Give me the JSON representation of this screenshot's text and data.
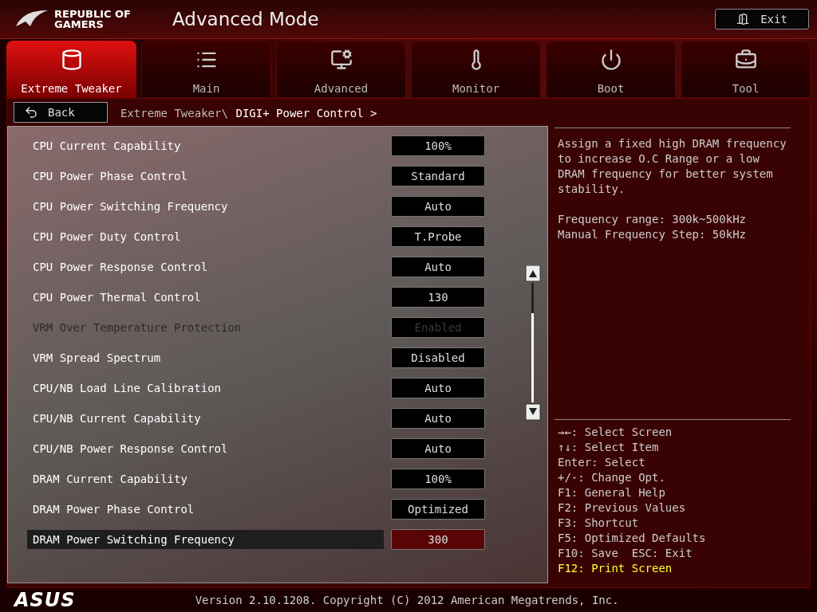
{
  "header": {
    "brand": "REPUBLIC OF GAMERS",
    "title": "Advanced Mode",
    "exit_button": "Exit"
  },
  "tabs": [
    {
      "label": "Extreme Tweaker",
      "kind": "tweaker",
      "selected": true
    },
    {
      "label": "Main",
      "kind": "main",
      "selected": false
    },
    {
      "label": "Advanced",
      "kind": "advanced",
      "selected": false
    },
    {
      "label": "Monitor",
      "kind": "monitor",
      "selected": false
    },
    {
      "label": "Boot",
      "kind": "boot",
      "selected": false
    },
    {
      "label": "Tool",
      "kind": "tool",
      "selected": false
    }
  ],
  "back_button": "Back",
  "breadcrumb": {
    "parent": "Extreme Tweaker\\",
    "current": "DIGI+ Power Control >"
  },
  "settings": [
    {
      "label": "CPU Current Capability",
      "value": "100%",
      "disabled": false,
      "selected": false
    },
    {
      "label": "CPU Power Phase Control",
      "value": "Standard",
      "disabled": false,
      "selected": false
    },
    {
      "label": "CPU Power Switching Frequency",
      "value": "Auto",
      "disabled": false,
      "selected": false
    },
    {
      "label": "CPU Power Duty Control",
      "value": "T.Probe",
      "disabled": false,
      "selected": false
    },
    {
      "label": "CPU Power Response Control",
      "value": "Auto",
      "disabled": false,
      "selected": false
    },
    {
      "label": "CPU Power Thermal Control",
      "value": "130",
      "disabled": false,
      "selected": false
    },
    {
      "label": "VRM Over Temperature Protection",
      "value": "Enabled",
      "disabled": true,
      "selected": false
    },
    {
      "label": "VRM Spread Spectrum",
      "value": "Disabled",
      "disabled": false,
      "selected": false
    },
    {
      "label": "CPU/NB Load Line Calibration",
      "value": "Auto",
      "disabled": false,
      "selected": false
    },
    {
      "label": "CPU/NB Current Capability",
      "value": "Auto",
      "disabled": false,
      "selected": false
    },
    {
      "label": "CPU/NB Power Response Control",
      "value": "Auto",
      "disabled": false,
      "selected": false
    },
    {
      "label": "DRAM Current Capability",
      "value": "100%",
      "disabled": false,
      "selected": false
    },
    {
      "label": "DRAM Power Phase Control",
      "value": "Optimized",
      "disabled": false,
      "selected": false
    },
    {
      "label": "DRAM Power Switching Frequency",
      "value": "300",
      "disabled": false,
      "selected": true
    }
  ],
  "help": {
    "description": "Assign a fixed high DRAM frequency to increase O.C Range or a low DRAM frequency for better system stability.",
    "details": [
      "Frequency range: 300k~500kHz",
      "Manual Frequency Step: 50kHz"
    ]
  },
  "keys": [
    {
      "text": "→←: Select Screen",
      "highlighted": false
    },
    {
      "text": "↑↓: Select Item",
      "highlighted": false
    },
    {
      "text": "Enter: Select",
      "highlighted": false
    },
    {
      "text": "+/-: Change Opt.",
      "highlighted": false
    },
    {
      "text": "F1: General Help",
      "highlighted": false
    },
    {
      "text": "F2: Previous Values",
      "highlighted": false
    },
    {
      "text": "F3: Shortcut",
      "highlighted": false
    },
    {
      "text": "F5: Optimized Defaults",
      "highlighted": false
    },
    {
      "text": "F10: Save  ESC: Exit",
      "highlighted": false
    },
    {
      "text": "F12: Print Screen",
      "highlighted": true
    }
  ],
  "footer": {
    "logo": "ASUS",
    "version": "Version 2.10.1208. Copyright (C) 2012 American Megatrends, Inc."
  }
}
